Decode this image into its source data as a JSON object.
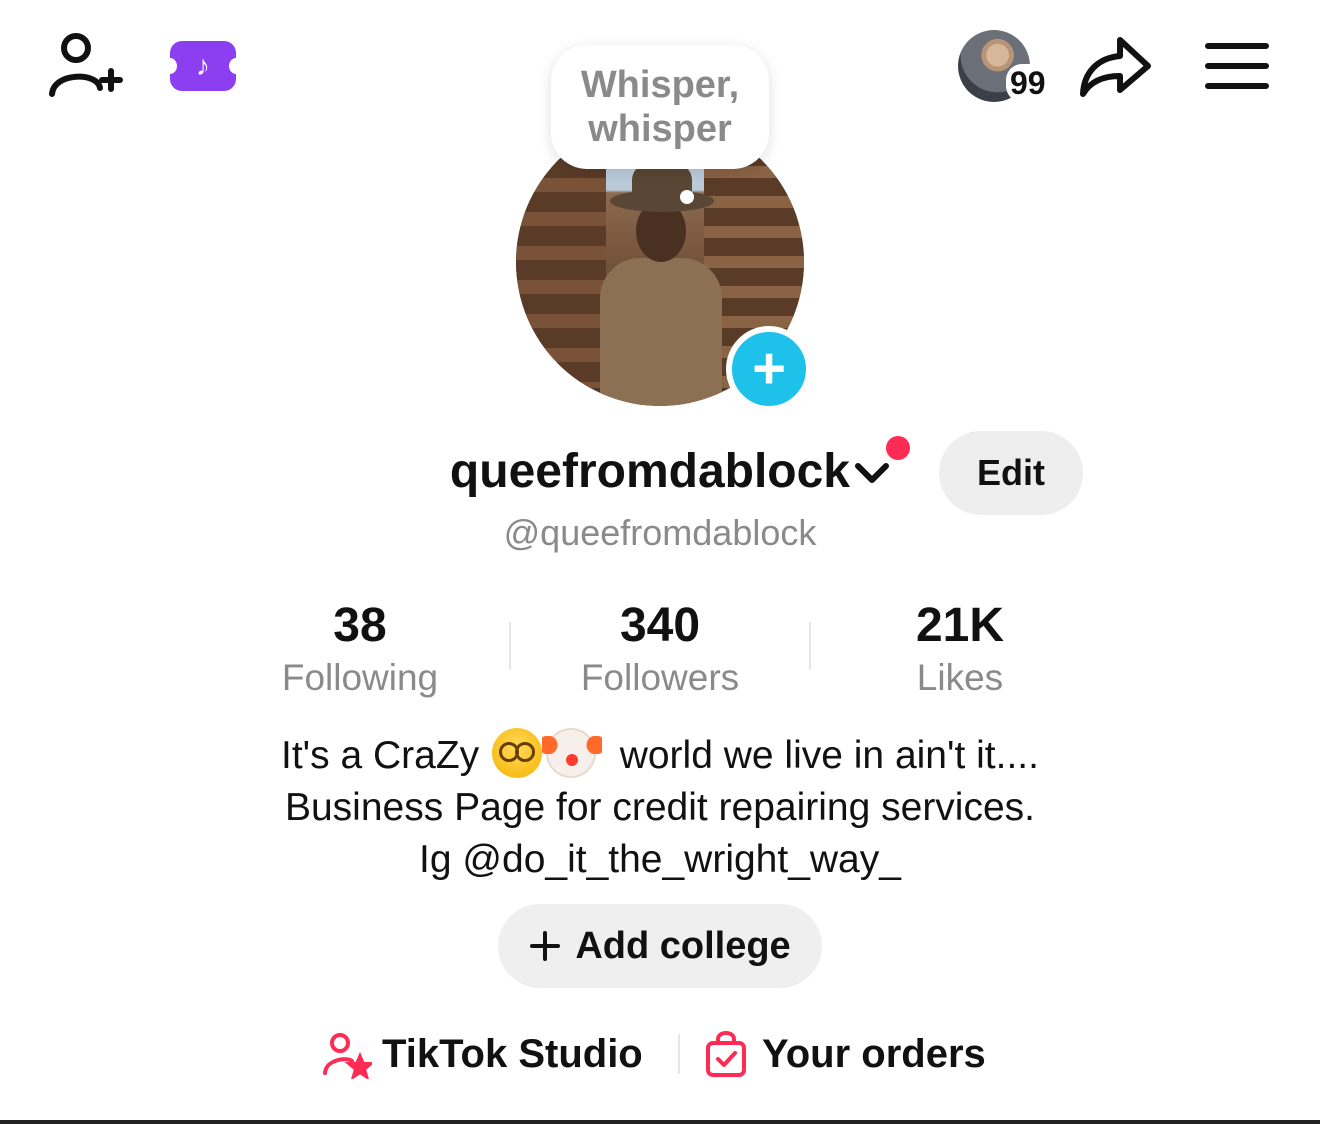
{
  "header": {
    "visitors_count": "99"
  },
  "note": {
    "text": "Whisper, whisper"
  },
  "profile": {
    "display_name": "queefromdablock",
    "username": "@queefromdablock",
    "edit_label": "Edit"
  },
  "stats": [
    {
      "value": "38",
      "label": "Following"
    },
    {
      "value": "340",
      "label": "Followers"
    },
    {
      "value": "21K",
      "label": "Likes"
    }
  ],
  "bio": {
    "line1_before": "It's a CraZy",
    "line1_after": "world we live in ain't it....",
    "line2": "Business Page for credit repairing services.",
    "line3": "Ig @do_it_the_wright_way_"
  },
  "add_college_label": "Add college",
  "links": {
    "studio": "TikTok Studio",
    "orders": "Your orders"
  },
  "colors": {
    "accent_red": "#fe2c55",
    "story_blue": "#1ec1ea",
    "ticket_purple": "#8b3ff0"
  }
}
